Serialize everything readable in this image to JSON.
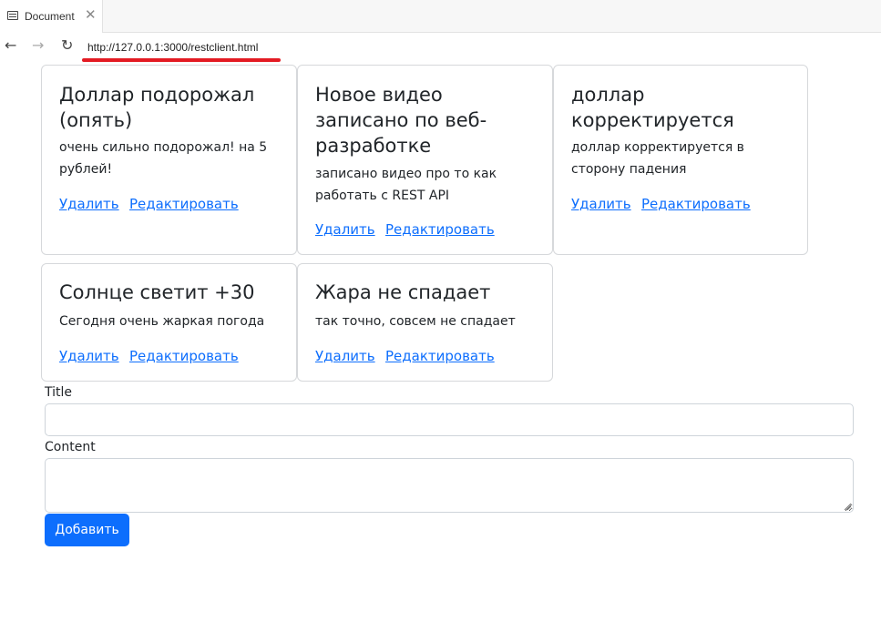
{
  "browser": {
    "tab_title": "Document",
    "tab_close": "✕",
    "back_icon": "←",
    "forward_icon": "→",
    "reload_icon": "↻",
    "url": "http://127.0.0.1:3000/restclient.html"
  },
  "cards": [
    {
      "title": "Доллар подорожал (опять)",
      "content": "очень сильно подорожал! на 5 рублей!",
      "delete_label": "Удалить",
      "edit_label": "Редактировать"
    },
    {
      "title": "Новое видео записано по веб-разработке",
      "content": "записано видео про то как работать с REST API",
      "delete_label": "Удалить",
      "edit_label": "Редактировать"
    },
    {
      "title": "доллар корректируется",
      "content": "доллар корректируется в сторону падения",
      "delete_label": "Удалить",
      "edit_label": "Редактировать"
    },
    {
      "title": "Солнце светит +30",
      "content": "Сегодня очень жаркая погода",
      "delete_label": "Удалить",
      "edit_label": "Редактировать"
    },
    {
      "title": "Жара не спадает",
      "content": "так точно, совсем не спадает",
      "delete_label": "Удалить",
      "edit_label": "Редактировать"
    }
  ],
  "form": {
    "title_label": "Title",
    "title_value": "",
    "content_label": "Content",
    "content_value": "",
    "submit_label": "Добавить"
  },
  "colors": {
    "link": "#0d6efd",
    "button": "#0d6efd",
    "url_underline": "#e31b23"
  }
}
